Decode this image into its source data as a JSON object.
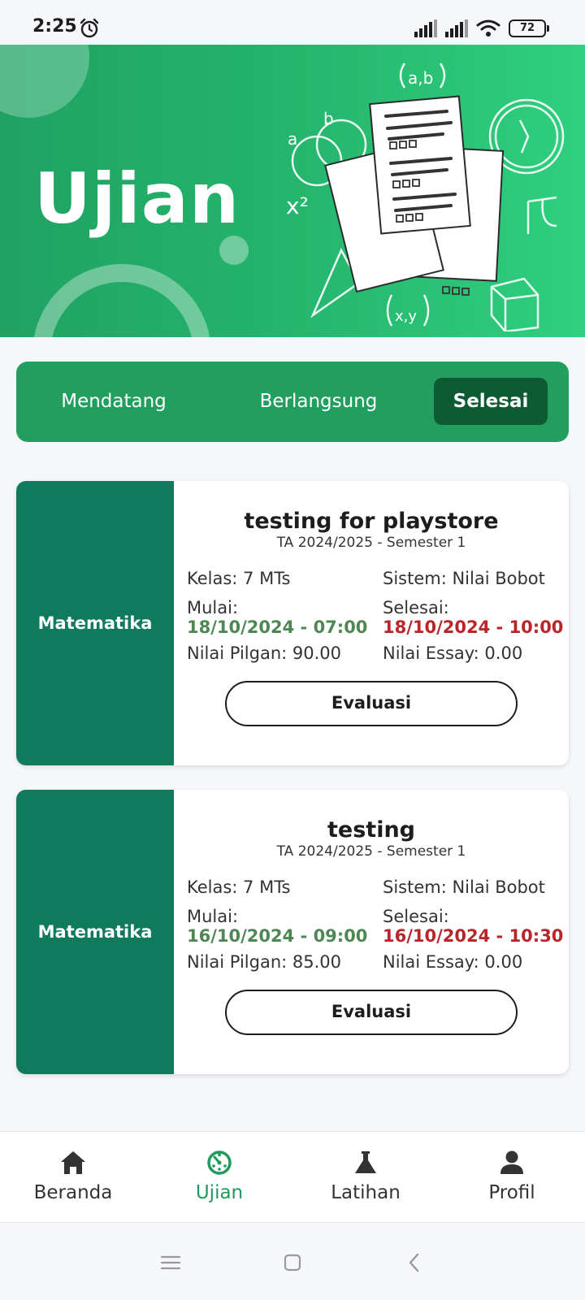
{
  "status_bar": {
    "time": "2:25",
    "battery": "72"
  },
  "header": {
    "title": "Ujian"
  },
  "tabs": [
    {
      "label": "Mendatang",
      "active": false
    },
    {
      "label": "Berlangsung",
      "active": false
    },
    {
      "label": "Selesai",
      "active": true
    }
  ],
  "exams": [
    {
      "subject": "Matematika",
      "title": "testing for playstore",
      "period": "TA 2024/2025 - Semester 1",
      "kelas": "Kelas: 7 MTs",
      "sistem": "Sistem: Nilai Bobot",
      "mulai_label": "Mulai:",
      "mulai_value": "18/10/2024 - 07:00",
      "selesai_label": "Selesai:",
      "selesai_value": "18/10/2024 - 10:00",
      "nilai_pilgan": "Nilai Pilgan: 90.00",
      "nilai_essay": "Nilai Essay: 0.00",
      "button": "Evaluasi"
    },
    {
      "subject": "Matematika",
      "title": "testing",
      "period": "TA 2024/2025 - Semester 1",
      "kelas": "Kelas: 7 MTs",
      "sistem": "Sistem: Nilai Bobot",
      "mulai_label": "Mulai:",
      "mulai_value": "16/10/2024 - 09:00",
      "selesai_label": "Selesai:",
      "selesai_value": "16/10/2024 - 10:30",
      "nilai_pilgan": "Nilai Pilgan: 85.00",
      "nilai_essay": "Nilai Essay: 0.00",
      "button": "Evaluasi"
    }
  ],
  "bottom_nav": [
    {
      "label": "Beranda",
      "icon": "home-icon",
      "active": false
    },
    {
      "label": "Ujian",
      "icon": "exam-timer-icon",
      "active": true
    },
    {
      "label": "Latihan",
      "icon": "flask-icon",
      "active": false
    },
    {
      "label": "Profil",
      "icon": "person-icon",
      "active": false
    }
  ],
  "colors": {
    "primary": "#25b56c",
    "tab_active": "#0e5b33",
    "card_side": "#107a5c",
    "start_date": "#4f8754",
    "end_date": "#b8262a",
    "nav_active": "#1e9a5c"
  }
}
